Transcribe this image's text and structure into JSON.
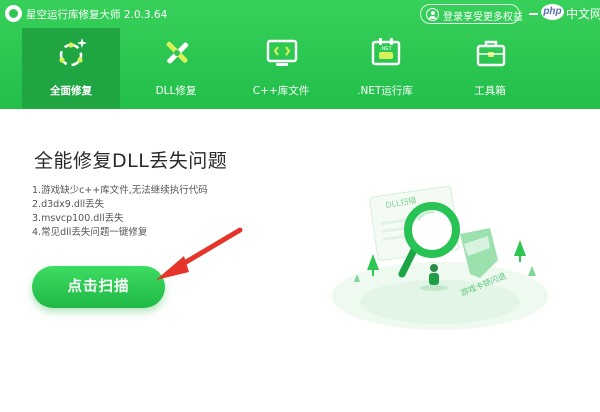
{
  "app": {
    "title": "星空运行库修复大师 2.0.3.64",
    "login_label": "登录享受更多权益",
    "watermark_php": "php",
    "watermark_cn": "中文网"
  },
  "tabs": [
    {
      "label": "全面修复",
      "icon": "full-repair-icon",
      "active": true
    },
    {
      "label": "DLL修复",
      "icon": "dll-repair-icon",
      "active": false
    },
    {
      "label": "C++库文件",
      "icon": "cpp-code-icon",
      "active": false
    },
    {
      "label": ".NET运行库",
      "icon": "dotnet-calendar-icon",
      "active": false
    },
    {
      "label": "工具箱",
      "icon": "toolbox-icon",
      "active": false
    }
  ],
  "main": {
    "headline": "全能修复DLL丢失问题",
    "problems": [
      "1.游戏缺少c++库文件,无法继续执行代码",
      "2.d3dx9.dll丢失",
      "3.msvcp100.dll丢失",
      "4.常见dll丢失问题一键修复"
    ],
    "scan_button": "点击扫描"
  },
  "illustration": {
    "paper_label": "DLL扫描",
    "banner_label": "游戏卡顿闪退"
  },
  "colors": {
    "brand_green": "#2fc653",
    "active_tab": "#1fa542",
    "arrow_red": "#e5342a"
  }
}
